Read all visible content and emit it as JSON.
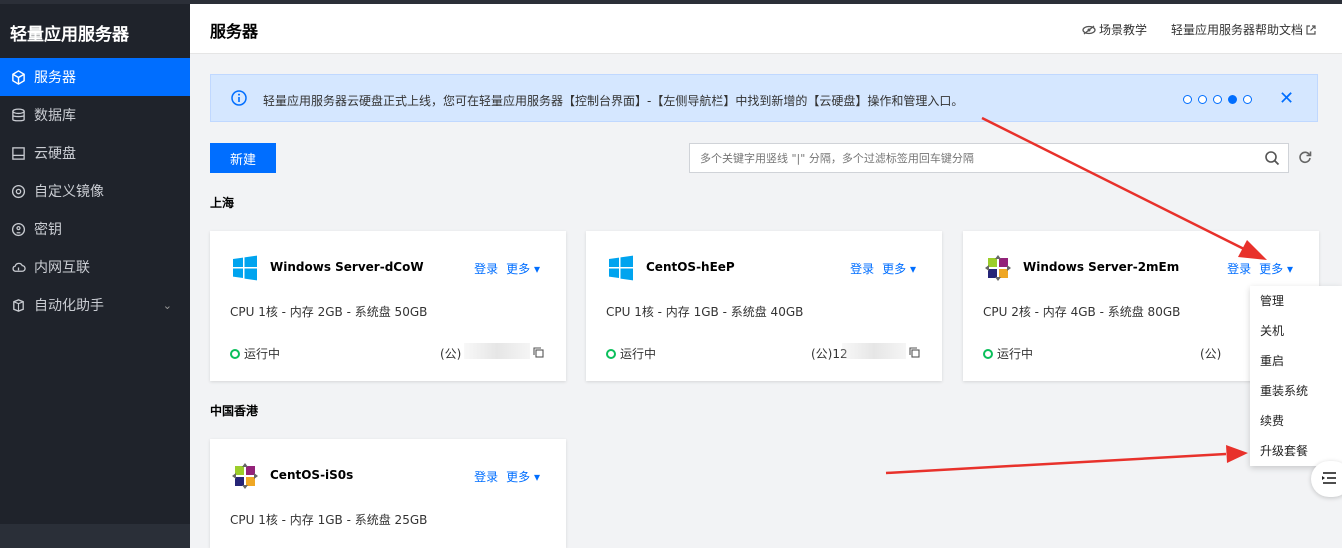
{
  "brand": "轻量应用服务器",
  "sidebar": {
    "items": [
      {
        "label": "服务器",
        "icon": "cube-icon"
      },
      {
        "label": "数据库",
        "icon": "database-icon"
      },
      {
        "label": "云硬盘",
        "icon": "disk-icon"
      },
      {
        "label": "自定义镜像",
        "icon": "image-icon"
      },
      {
        "label": "密钥",
        "icon": "key-icon"
      },
      {
        "label": "内网互联",
        "icon": "cloud-link-icon"
      },
      {
        "label": "自动化助手",
        "icon": "robot-icon"
      }
    ]
  },
  "header": {
    "title": "服务器",
    "link_tutorial": "场景教学",
    "link_help": "轻量应用服务器帮助文档"
  },
  "notice": {
    "text": "轻量应用服务器云硬盘正式上线，您可在轻量应用服务器【控制台界面】-【左侧导航栏】中找到新增的【云硬盘】操作和管理入口。",
    "dots": 5,
    "active_dot": 4
  },
  "toolbar": {
    "new_label": "新建",
    "search_placeholder": "多个关键字用竖线 \"|\" 分隔，多个过滤标签用回车键分隔"
  },
  "regions": [
    "上海",
    "中国香港"
  ],
  "cards": [
    {
      "name": "Windows Server-dCoW",
      "os": "windows",
      "login": "登录",
      "more": "更多",
      "spec": "CPU 1核 - 内存 2GB - 系统盘 50GB",
      "status": "运行中",
      "ip": "(公)"
    },
    {
      "name": "CentOS-hEeP",
      "os": "windows",
      "login": "登录",
      "more": "更多",
      "spec": "CPU 1核 - 内存 1GB - 系统盘 40GB",
      "status": "运行中",
      "ip": "(公)12"
    },
    {
      "name": "Windows Server-2mEm",
      "os": "centos",
      "login": "登录",
      "more": "更多",
      "spec": "CPU 2核 - 内存 4GB - 系统盘 80GB",
      "status": "运行中",
      "ip": "(公)"
    },
    {
      "name": "CentOS-iS0s",
      "os": "centos",
      "login": "登录",
      "more": "更多",
      "spec": "CPU 1核 - 内存 1GB - 系统盘 25GB",
      "status": "",
      "ip": ""
    }
  ],
  "more_menu": [
    "管理",
    "关机",
    "重启",
    "重装系统",
    "续费",
    "升级套餐"
  ],
  "colors": {
    "accent": "#006eff",
    "sidebar_bg": "#1f232b",
    "running": "#0abf5b",
    "arrow": "#e8312b"
  }
}
